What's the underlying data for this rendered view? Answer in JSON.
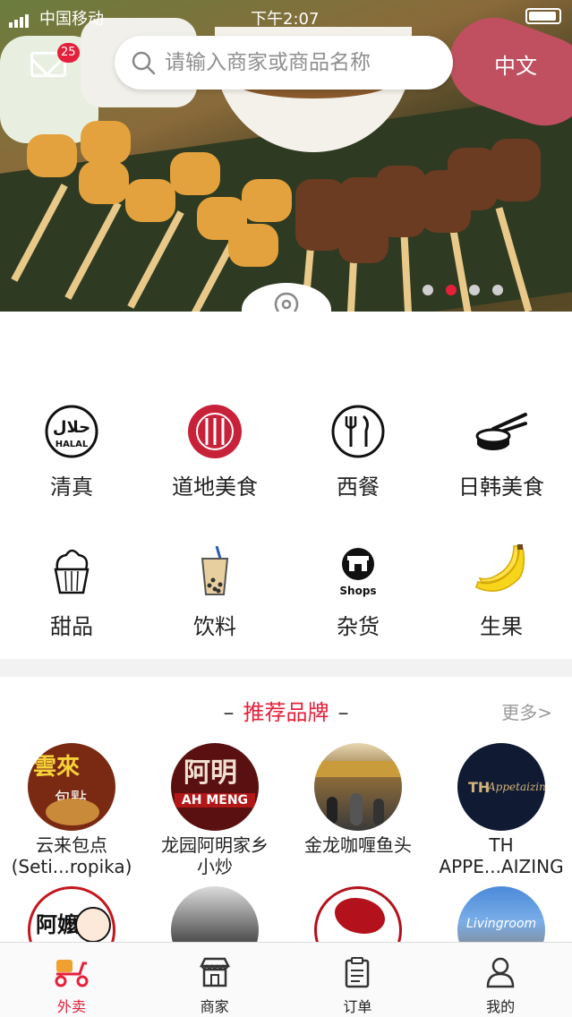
{
  "status_bar": {
    "carrier": "中国移动",
    "time": "下午2:07"
  },
  "header": {
    "unread_count": "25",
    "search_placeholder": "请输入商家或商品名称",
    "language": "中文"
  },
  "banner": {
    "slide_count": 4,
    "active_slide": 2
  },
  "categories": [
    {
      "label": "清真",
      "icon": "halal-icon"
    },
    {
      "label": "道地美食",
      "icon": "local-food-icon"
    },
    {
      "label": "西餐",
      "icon": "western-food-icon"
    },
    {
      "label": "日韩美食",
      "icon": "japanese-korean-food-icon"
    },
    {
      "label": "甜品",
      "icon": "cupcake-icon"
    },
    {
      "label": "饮料",
      "icon": "bubble-tea-icon"
    },
    {
      "label": "杂货",
      "icon": "shop-icon",
      "icon_text": "Shops"
    },
    {
      "label": "生果",
      "icon": "banana-icon"
    }
  ],
  "brands": {
    "title": "推荐品牌",
    "more": "更多>",
    "items": [
      {
        "line1": "云来包点",
        "line2": "(Seti...ropika)"
      },
      {
        "line1": "龙园阿明家乡",
        "line2": "小炒"
      },
      {
        "line1": "金龙咖喱鱼头",
        "line2": ""
      },
      {
        "line1": "TH",
        "line2": "APPE...AIZING"
      }
    ],
    "logo_texts": {
      "brand1": "雲來",
      "brand1_sub": "包點",
      "brand2": "阿明",
      "brand2_sub": "AH MENG",
      "brand4": "Appetaizing",
      "brand4_sub": "TH",
      "brand5": "阿嬤",
      "brand8": "Livingroom"
    }
  },
  "tabs": [
    {
      "label": "外卖",
      "icon": "scooter-icon",
      "active": true
    },
    {
      "label": "商家",
      "icon": "store-icon",
      "active": false
    },
    {
      "label": "订单",
      "icon": "order-icon",
      "active": false
    },
    {
      "label": "我的",
      "icon": "profile-icon",
      "active": false
    }
  ],
  "colors": {
    "accent": "#e5203a",
    "background": "#f2f2f2"
  }
}
